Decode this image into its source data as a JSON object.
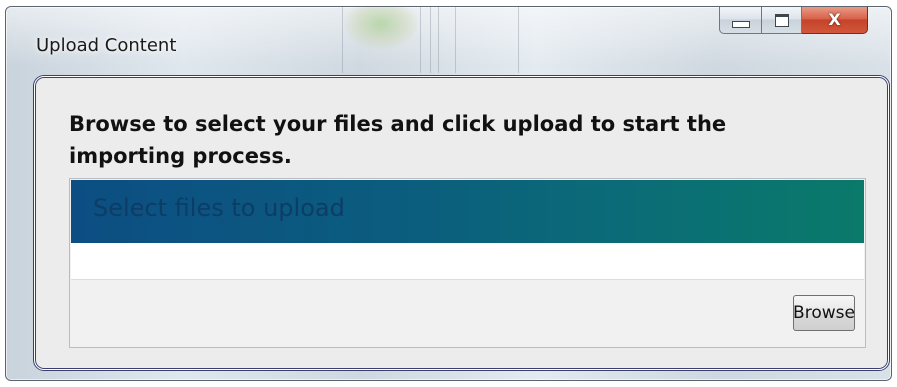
{
  "window": {
    "title": "Upload Content",
    "caption": {
      "minimize_icon": "minimize-icon",
      "maximize_icon": "maximize-icon",
      "close_glyph": "X"
    }
  },
  "dialog": {
    "instructions": "Browse to select your files and click upload to start the importing process.",
    "upload_area": {
      "header_text": "Select files to upload",
      "browse_label": "Browse"
    }
  },
  "colors": {
    "header_gradient_start": "#0c4e83",
    "header_gradient_end": "#0a7a6a",
    "close_button": "#c4432a",
    "client_border": "#3a3f6e"
  }
}
